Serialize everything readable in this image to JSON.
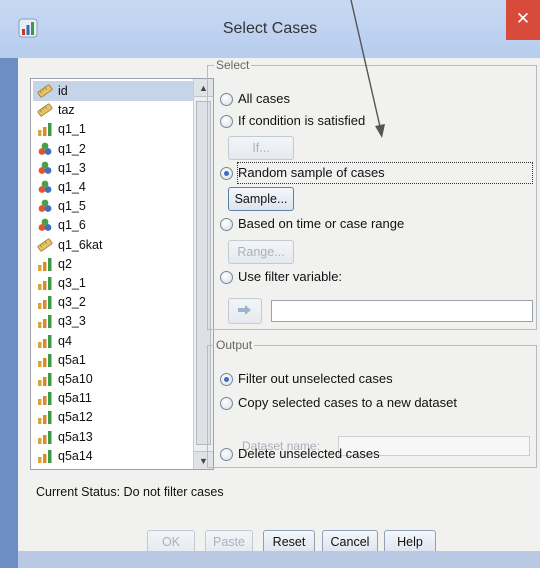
{
  "window": {
    "title": "Select Cases"
  },
  "variables": [
    {
      "name": "id",
      "icon": "ruler-icon",
      "selected": true
    },
    {
      "name": "taz",
      "icon": "ruler-icon"
    },
    {
      "name": "q1_1",
      "icon": "bar-chart-icon"
    },
    {
      "name": "q1_2",
      "icon": "nominal-circles-icon"
    },
    {
      "name": "q1_3",
      "icon": "nominal-circles-icon"
    },
    {
      "name": "q1_4",
      "icon": "nominal-circles-icon"
    },
    {
      "name": "q1_5",
      "icon": "nominal-circles-icon"
    },
    {
      "name": "q1_6",
      "icon": "nominal-circles-icon"
    },
    {
      "name": "q1_6kat",
      "icon": "ruler-icon"
    },
    {
      "name": "q2",
      "icon": "bar-chart-icon"
    },
    {
      "name": "q3_1",
      "icon": "bar-chart-icon"
    },
    {
      "name": "q3_2",
      "icon": "bar-chart-icon"
    },
    {
      "name": "q3_3",
      "icon": "bar-chart-icon"
    },
    {
      "name": "q4",
      "icon": "bar-chart-icon"
    },
    {
      "name": "q5a1",
      "icon": "bar-chart-icon"
    },
    {
      "name": "q5a10",
      "icon": "bar-chart-icon"
    },
    {
      "name": "q5a11",
      "icon": "bar-chart-icon"
    },
    {
      "name": "q5a12",
      "icon": "bar-chart-icon"
    },
    {
      "name": "q5a13",
      "icon": "bar-chart-icon"
    },
    {
      "name": "q5a14",
      "icon": "bar-chart-icon"
    }
  ],
  "select": {
    "legend": "Select",
    "all_cases": "All cases",
    "if_condition": "If condition is satisfied",
    "if_button": "If...",
    "random_sample": "Random sample of cases",
    "sample_button": "Sample...",
    "based_on_time": "Based on time or case range",
    "range_button": "Range...",
    "use_filter": "Use filter variable:",
    "selected_option": "random_sample"
  },
  "output": {
    "legend": "Output",
    "filter_out": "Filter out unselected cases",
    "copy_selected": "Copy selected cases to a new dataset",
    "dataset_name_label": "Dataset name:",
    "delete_unselected": "Delete unselected cases",
    "selected_option": "filter_out"
  },
  "status": {
    "text": "Current Status: Do not filter cases"
  },
  "buttons": {
    "ok": "OK",
    "paste": "Paste",
    "reset": "Reset",
    "cancel": "Cancel",
    "help": "Help"
  },
  "colors": {
    "radio_selected": "#3a6fc4",
    "titlebar": "#c8d9f2",
    "close": "#d84a3a"
  }
}
